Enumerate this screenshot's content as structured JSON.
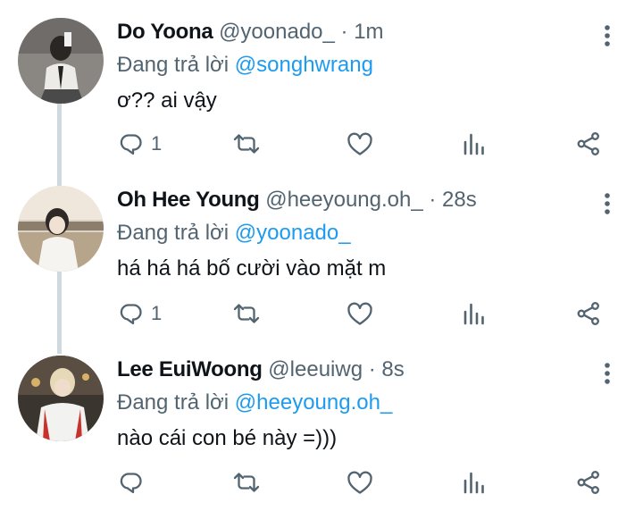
{
  "colors": {
    "thread_line": "#cfd9de",
    "mention": "#1d9bf0",
    "muted": "#536471",
    "text": "#0f1419"
  },
  "tweets": [
    {
      "name": "Do Yoona",
      "handle": "@yoonado_",
      "time": "· 1m",
      "reply_prefix": "Đang trả lời",
      "reply_to": "@songhwrang",
      "text": "ơ?? ai vậy",
      "reply_count": "1",
      "avatar_icon": "user-photo-icon"
    },
    {
      "name": "Oh Hee Young",
      "handle": "@heeyoung.oh_",
      "time": "· 28s",
      "reply_prefix": "Đang trả lời",
      "reply_to": "@yoonado_",
      "text": "há há há bố cười vào mặt m",
      "reply_count": "1",
      "avatar_icon": "user-photo-icon"
    },
    {
      "name": "Lee EuiWoong",
      "handle": "@leeuiwg",
      "time": "· 8s",
      "reply_prefix": "Đang trả lời",
      "reply_to": "@heeyoung.oh_",
      "text": "nào cái con bé này =)))",
      "reply_count": "",
      "avatar_icon": "user-photo-icon"
    }
  ]
}
